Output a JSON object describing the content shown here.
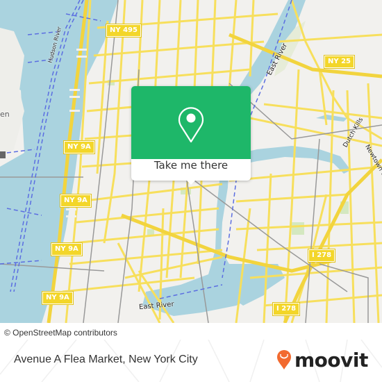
{
  "map": {
    "attribution": "© OpenStreetMap contributors",
    "colors": {
      "water": "#aad3df",
      "land": "#f2f1ee",
      "road_major": "#f7df5c",
      "road_minor": "#ffffff",
      "rail": "#999999",
      "ferry": "#5b6ee1",
      "park": "#d4e8c0"
    },
    "route_shields": [
      {
        "label": "NY 495"
      },
      {
        "label": "NY 25"
      },
      {
        "label": "NY 9A"
      },
      {
        "label": "NY 9A"
      },
      {
        "label": "NY 9A"
      },
      {
        "label": "NY 9A"
      },
      {
        "label": "I 278"
      },
      {
        "label": "I 278"
      }
    ],
    "water_labels": [
      {
        "label": "Hudson River"
      },
      {
        "label": "East River"
      },
      {
        "label": "East River"
      },
      {
        "label": "Dutch Kills"
      },
      {
        "label": "Newtown Creek"
      }
    ],
    "place_labels": [
      {
        "label": "en"
      }
    ]
  },
  "popup": {
    "button_label": "Take me there",
    "accent_color": "#1eb769",
    "icon": "map-pin-icon"
  },
  "footer": {
    "place_name": "Avenue A Flea Market, New York City",
    "brand": "moovit",
    "brand_color": "#f26a2f"
  }
}
